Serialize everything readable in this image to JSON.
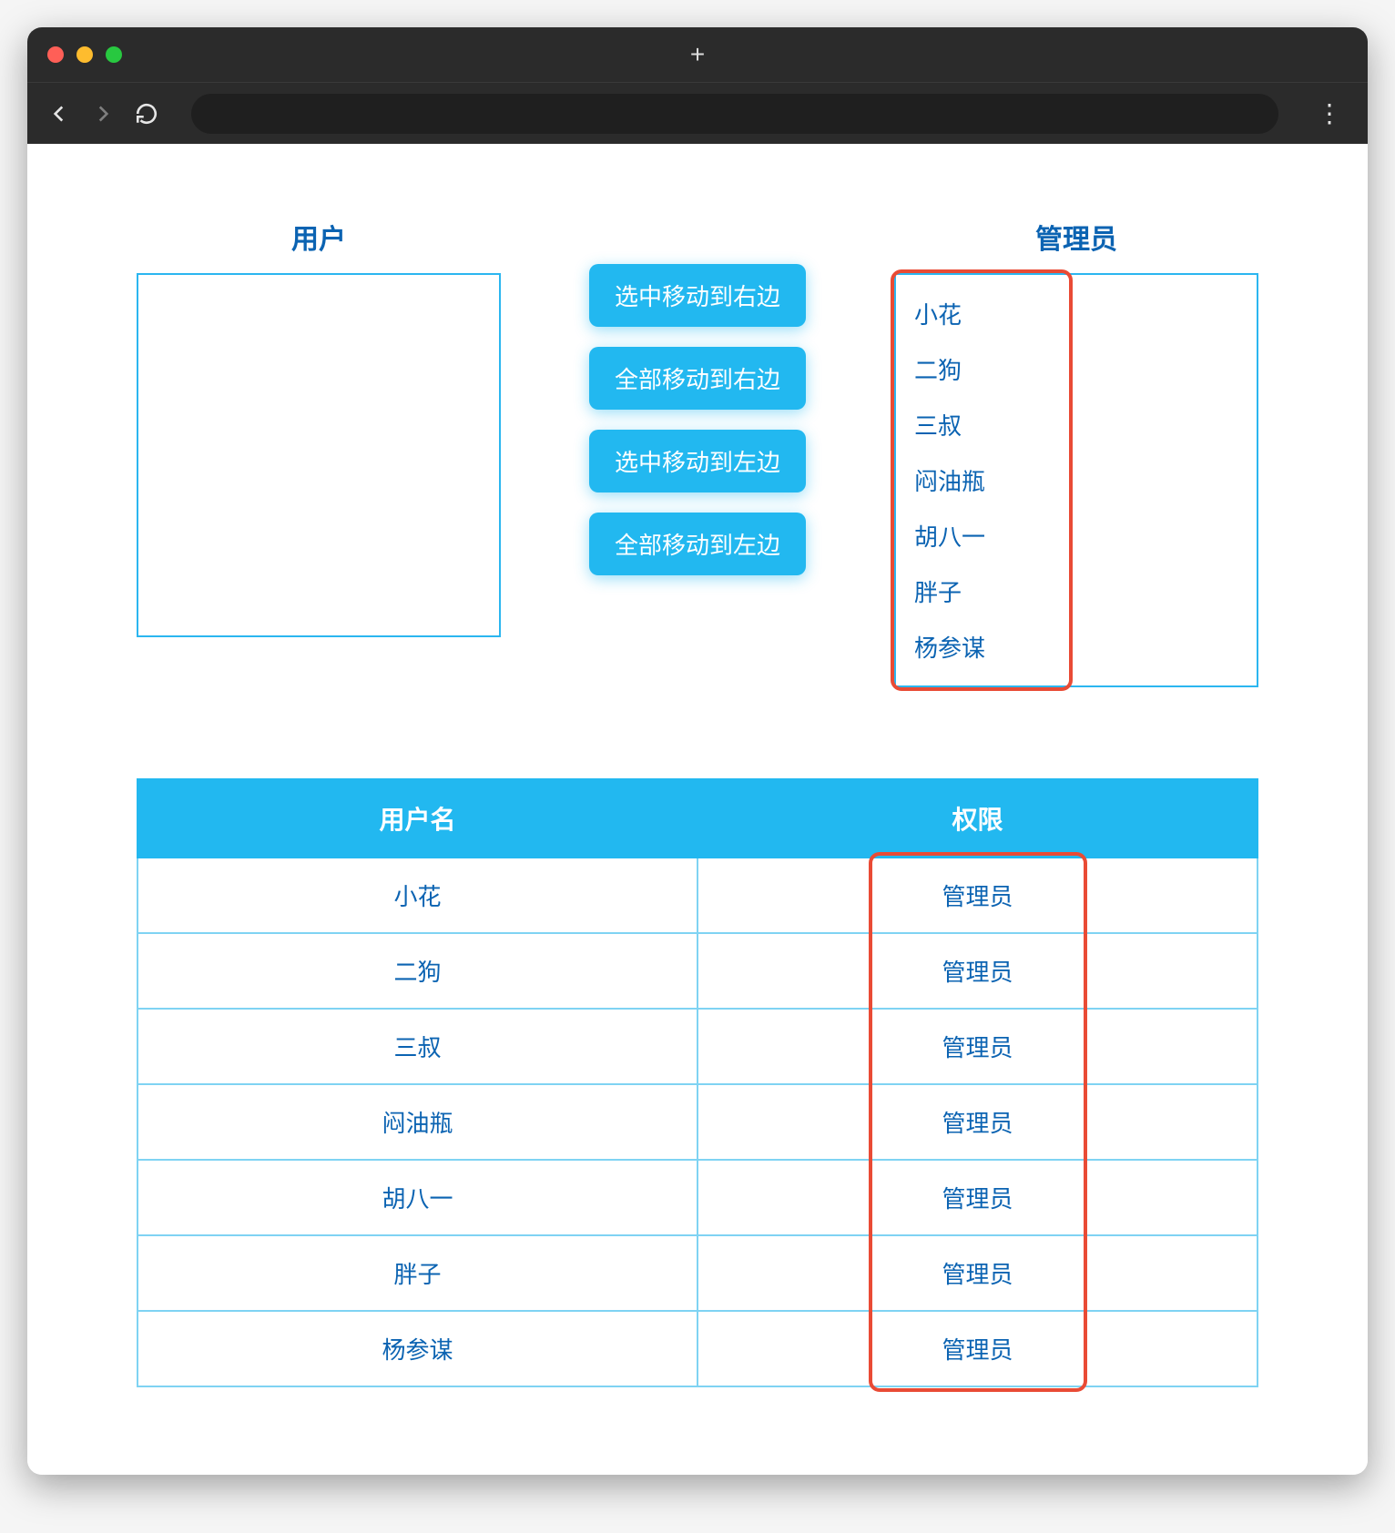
{
  "transfer": {
    "left_title": "用户",
    "right_title": "管理员",
    "left_items": [],
    "right_items": [
      "小花",
      "二狗",
      "三叔",
      "闷油瓶",
      "胡八一",
      "胖子",
      "杨参谋"
    ],
    "buttons": {
      "move_selected_right": "选中移动到右边",
      "move_all_right": "全部移动到右边",
      "move_selected_left": "选中移动到左边",
      "move_all_left": "全部移动到左边"
    }
  },
  "table": {
    "headers": {
      "username": "用户名",
      "permission": "权限"
    },
    "rows": [
      {
        "username": "小花",
        "permission": "管理员"
      },
      {
        "username": "二狗",
        "permission": "管理员"
      },
      {
        "username": "三叔",
        "permission": "管理员"
      },
      {
        "username": "闷油瓶",
        "permission": "管理员"
      },
      {
        "username": "胡八一",
        "permission": "管理员"
      },
      {
        "username": "胖子",
        "permission": "管理员"
      },
      {
        "username": "杨参谋",
        "permission": "管理员"
      }
    ]
  },
  "annotations": {
    "right_list_highlight": true,
    "permission_column_highlight": true
  }
}
